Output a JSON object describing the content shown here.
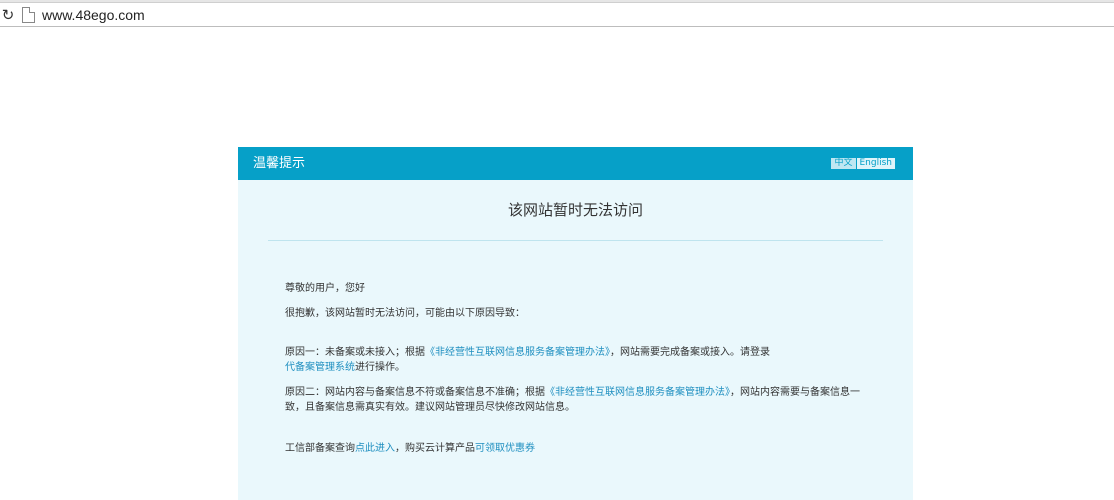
{
  "browser": {
    "url": "www.48ego.com"
  },
  "card": {
    "header_title": "温馨提示",
    "lang_zh": "中文",
    "lang_en": "English",
    "headline": "该网站暂时无法访问",
    "greeting": "尊敬的用户，您好",
    "apology": "很抱歉，该网站暂时无法访问，可能由以下原因导致：",
    "reason1": {
      "prefix": "原因一：未备案或未接入；根据",
      "link1": "《非经营性互联网信息服务备案管理办法》",
      "middle": "，网站需要完成备案或接入。请登录",
      "link2": "代备案管理系统",
      "suffix": "进行操作。"
    },
    "reason2": {
      "prefix": "原因二：网站内容与备案信息不符或备案信息不准确；根据",
      "link1": "《非经营性互联网信息服务备案管理办法》",
      "suffix": "，网站内容需要与备案信息一致，且备案信息需真实有效。建议网站管理员尽快修改网站信息。"
    },
    "footer": {
      "prefix": "工信部备案查询",
      "link1": "点此进入",
      "middle": "，购买云计算产品",
      "link2": "可领取优惠券"
    }
  },
  "colors": {
    "header_bg": "#06a0c8",
    "card_bg": "#eaf8fc",
    "link": "#1f8fc0"
  },
  "icons": {
    "reload": "reload-icon",
    "page": "page-icon"
  }
}
